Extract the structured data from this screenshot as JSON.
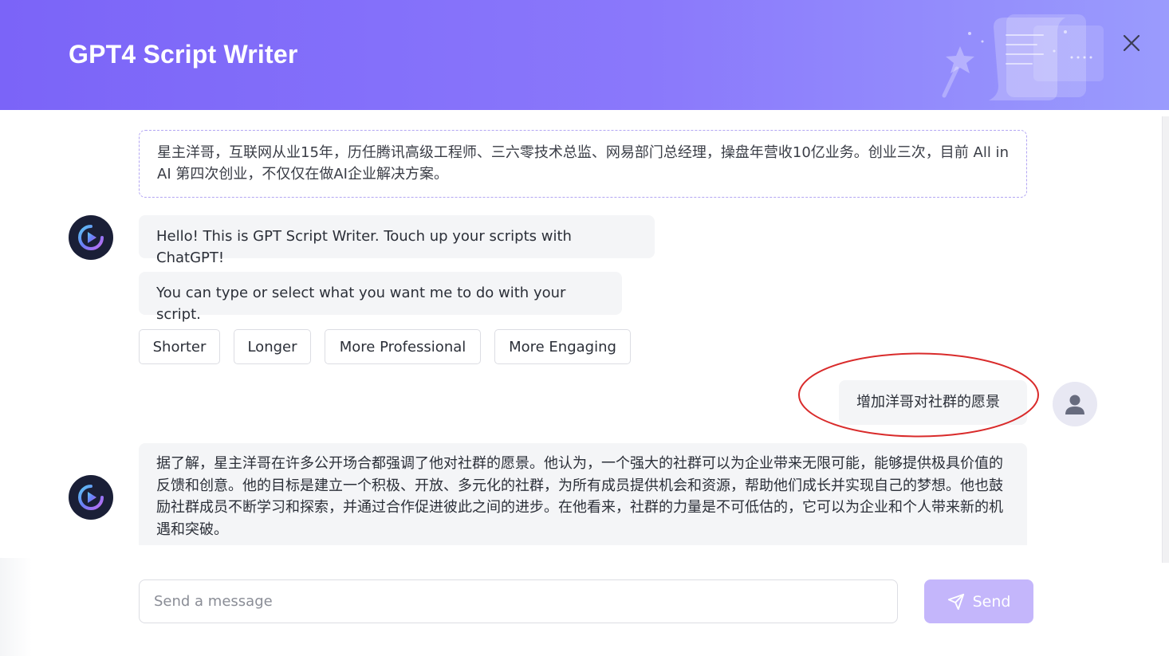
{
  "header": {
    "title": "GPT4 Script Writer",
    "background_colors": [
      "#7b64f8",
      "#9a9bfd"
    ],
    "art_icon": "script-scroll-illustration",
    "close_icon": "close-icon"
  },
  "chat": {
    "context_text": "星主洋哥，互联网从业15年，历任腾讯高级工程师、三六零技术总监、网易部门总经理，操盘年营收10亿业务。创业三次，目前 All in AI 第四次创业，不仅仅在做AI企业解决方案。",
    "bot_greeting": "Hello! This is GPT Script Writer. Touch up your scripts with ChatGPT!",
    "bot_prompt": "You can type or select what you want me to do with your script.",
    "options": [
      {
        "label": "Shorter"
      },
      {
        "label": "Longer"
      },
      {
        "label": "More Professional"
      },
      {
        "label": "More Engaging"
      }
    ],
    "user_message": "增加洋哥对社群的愿景",
    "bot_reply": "据了解，星主洋哥在许多公开场合都强调了他对社群的愿景。他认为，一个强大的社群可以为企业带来无限可能，能够提供极具价值的反馈和创意。他的目标是建立一个积极、开放、多元化的社群，为所有成员提供机会和资源，帮助他们成长并实现自己的梦想。他也鼓励社群成员不断学习和探索，并通过合作促进彼此之间的进步。在他看来，社群的力量是不可低估的，它可以为企业和个人带来新的机遇和突破。"
  },
  "composer": {
    "placeholder": "Send a message",
    "send_label": "Send",
    "send_color": "#c4b6fb"
  },
  "annotation": {
    "color": "#d92b2b",
    "shape": "ellipse"
  }
}
